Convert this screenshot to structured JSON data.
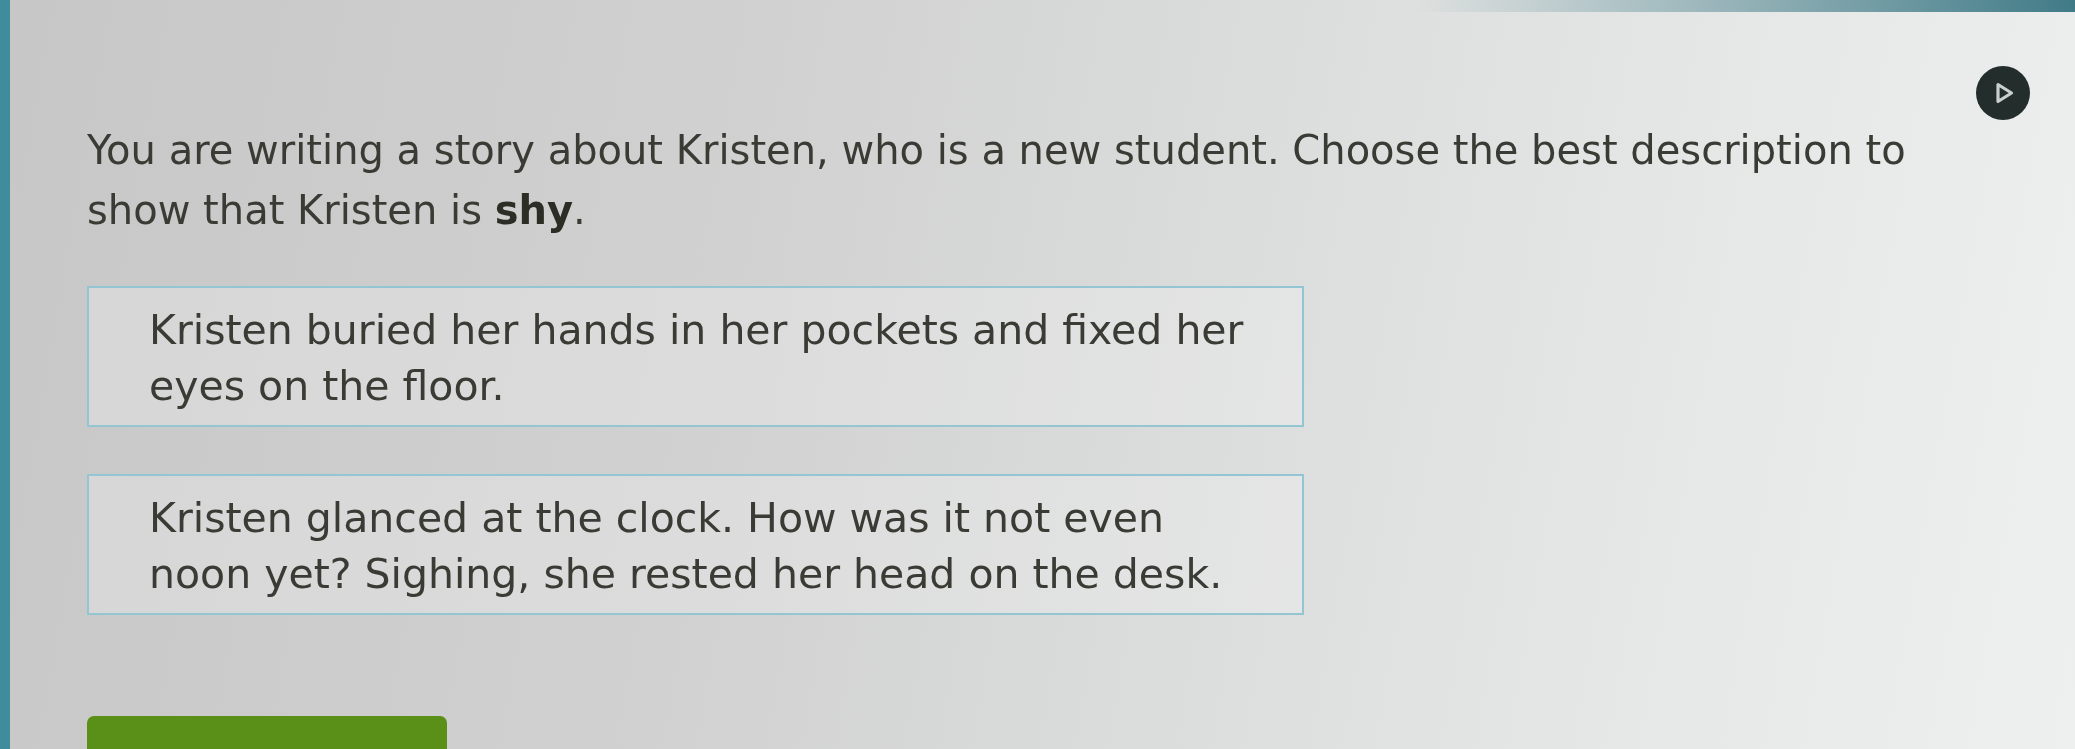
{
  "prompt": "You are writing a story about Kristen, who is a new student. Choose the best description to show that Kristen is **shy**.",
  "options": [
    {
      "text": "Kristen buried her hands in her pockets and fixed her eyes on the floor.",
      "selected": false
    },
    {
      "text": "Kristen glanced at the clock. How was it not even noon yet? Sighing, she rested her head on the desk.",
      "selected": false
    }
  ]
}
